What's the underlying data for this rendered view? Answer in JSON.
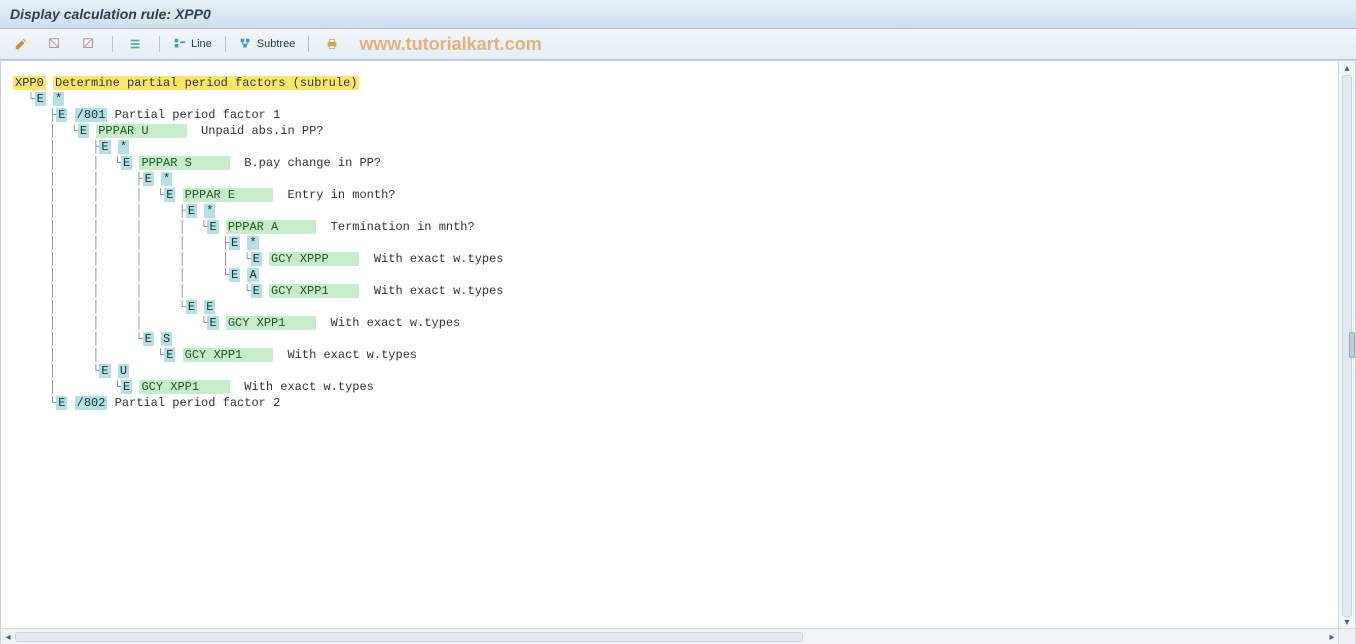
{
  "title": "Display calculation rule: XPP0",
  "toolbar": {
    "line_label": "Line",
    "subtree_label": "Subtree"
  },
  "watermark": "www.tutorialkart.com",
  "tree": {
    "root_code": "XPP0",
    "root_desc": "Determine partial period factors (subrule)",
    "lines": [
      {
        "prefix": "  └",
        "tag": "E",
        "code": "*",
        "desc": ""
      },
      {
        "prefix": "     ├",
        "tag": "E",
        "code": "/801",
        "desc": "Partial period factor 1"
      },
      {
        "prefix": "     │  └",
        "tag": "E",
        "op": "PPPAR U",
        "desc": "Unpaid abs.in PP?"
      },
      {
        "prefix": "     │     ├",
        "tag": "E",
        "code": "*",
        "desc": ""
      },
      {
        "prefix": "     │     │  └",
        "tag": "E",
        "op": "PPPAR S",
        "desc": "B.pay change in PP?"
      },
      {
        "prefix": "     │     │     ├",
        "tag": "E",
        "code": "*",
        "desc": ""
      },
      {
        "prefix": "     │     │     │  └",
        "tag": "E",
        "op": "PPPAR E",
        "desc": "Entry in month?"
      },
      {
        "prefix": "     │     │     │     ├",
        "tag": "E",
        "code": "*",
        "desc": ""
      },
      {
        "prefix": "     │     │     │     │  └",
        "tag": "E",
        "op": "PPPAR A",
        "desc": "Termination in mnth?"
      },
      {
        "prefix": "     │     │     │     │     ├",
        "tag": "E",
        "code": "*",
        "desc": ""
      },
      {
        "prefix": "     │     │     │     │     │  └",
        "tag": "E",
        "op": "GCY XPPP",
        "desc": "With exact w.types"
      },
      {
        "prefix": "     │     │     │     │     └",
        "tag": "E",
        "code": "A",
        "desc": ""
      },
      {
        "prefix": "     │     │     │     │        └",
        "tag": "E",
        "op": "GCY XPP1",
        "desc": "With exact w.types"
      },
      {
        "prefix": "     │     │     │     └",
        "tag": "E",
        "code": "E",
        "desc": ""
      },
      {
        "prefix": "     │     │     │        └",
        "tag": "E",
        "op": "GCY XPP1",
        "desc": "With exact w.types"
      },
      {
        "prefix": "     │     │     └",
        "tag": "E",
        "code": "S",
        "desc": ""
      },
      {
        "prefix": "     │     │        └",
        "tag": "E",
        "op": "GCY XPP1",
        "desc": "With exact w.types"
      },
      {
        "prefix": "     │     └",
        "tag": "E",
        "code": "U",
        "desc": ""
      },
      {
        "prefix": "     │        └",
        "tag": "E",
        "op": "GCY XPP1",
        "desc": "With exact w.types"
      },
      {
        "prefix": "     └",
        "tag": "E",
        "code": "/802",
        "desc": "Partial period factor 2"
      }
    ]
  },
  "op_pad": 12
}
